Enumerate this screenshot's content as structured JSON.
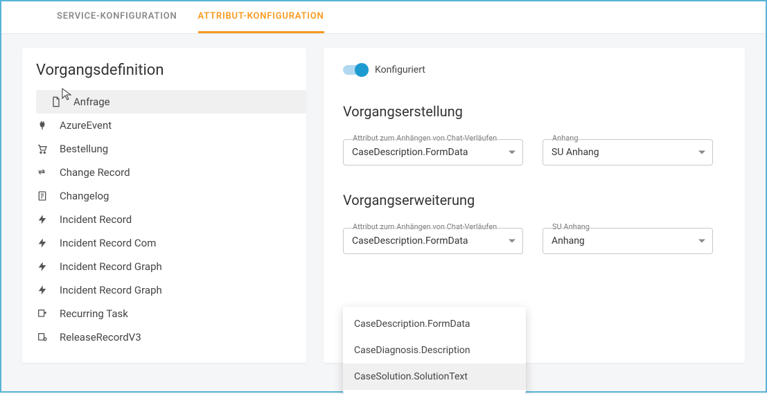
{
  "tabs": {
    "service": "SERVICE-KONFIGURATION",
    "attribute": "ATTRIBUT-KONFIGURATION"
  },
  "left": {
    "title": "Vorgangsdefinition",
    "items": [
      {
        "label": "Anfrage"
      },
      {
        "label": "AzureEvent"
      },
      {
        "label": "Bestellung"
      },
      {
        "label": "Change Record"
      },
      {
        "label": "Changelog"
      },
      {
        "label": "Incident Record"
      },
      {
        "label": "Incident Record Com"
      },
      {
        "label": "Incident Record Graph"
      },
      {
        "label": "Incident Record Graph"
      },
      {
        "label": "Recurring Task"
      },
      {
        "label": "ReleaseRecordV3"
      }
    ]
  },
  "right": {
    "toggle_label": "Konfiguriert",
    "section1": {
      "title": "Vorgangserstellung",
      "field1_label": "Attribut zum Anhängen von Chat-Verläufen",
      "field1_value": "CaseDescription.FormData",
      "field2_label": "Anhang",
      "field2_value": "SU Anhang"
    },
    "section2": {
      "title": "Vorgangserweiterung",
      "field1_label": "Attribut zum Anhängen von Chat-Verläufen",
      "field1_value": "CaseDescription.FormData",
      "field2_label": "SU Anhang",
      "field2_value": "Anhang"
    },
    "dropdown": {
      "options": [
        "CaseDescription.FormData",
        "CaseDiagnosis.Description",
        "CaseSolution.SolutionText"
      ]
    }
  }
}
